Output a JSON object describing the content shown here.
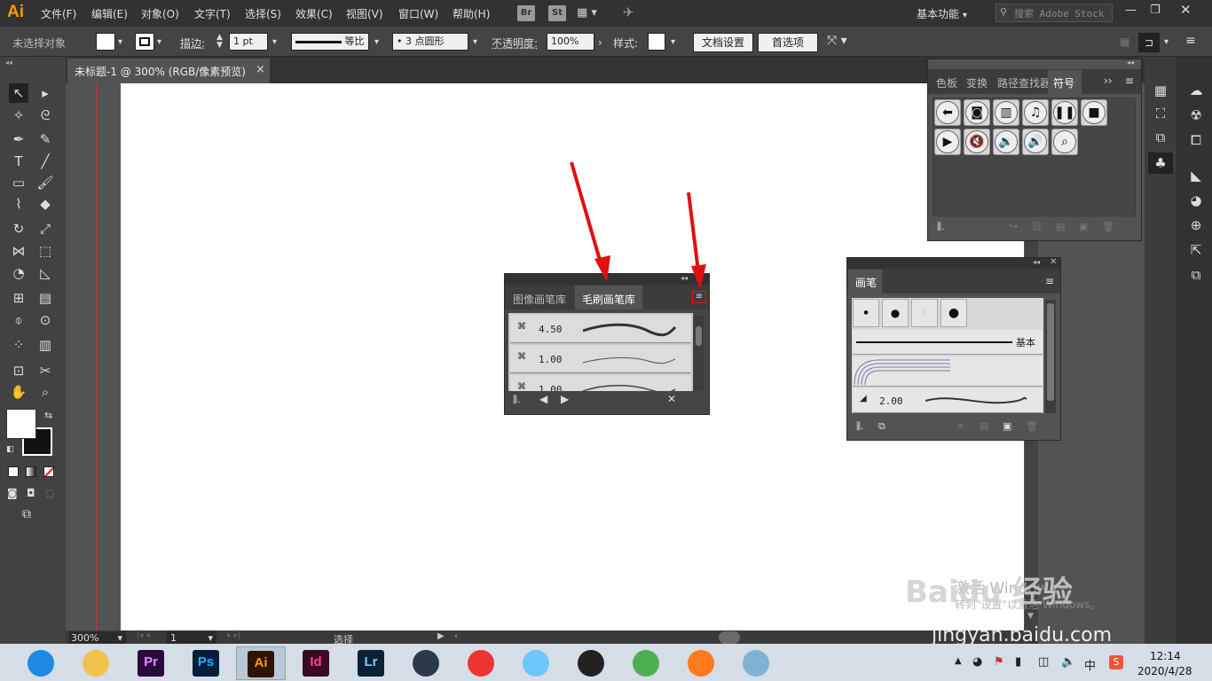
{
  "app": {
    "logo": "Ai"
  },
  "menu": [
    "文件(F)",
    "编辑(E)",
    "对象(O)",
    "文字(T)",
    "选择(S)",
    "效果(C)",
    "视图(V)",
    "窗口(W)",
    "帮助(H)"
  ],
  "appbar": {
    "br": "Br",
    "st": "St",
    "workspace": "基本功能",
    "search_placeholder": "搜索 Adobe Stock"
  },
  "control": {
    "selection": "未选择对象",
    "stroke_label": "描边:",
    "stroke_value": "1 pt",
    "stroke_profile": "等比",
    "brush_def": "3 点圆形",
    "opacity_label": "不透明度:",
    "opacity_value": "100%",
    "style_label": "样式:",
    "doc_setup": "文档设置",
    "preferences": "首选项"
  },
  "document": {
    "tab_title": "未标题-1 @ 300% (RGB/像素预览)",
    "close": "×"
  },
  "status": {
    "zoom": "300%",
    "page": "1",
    "tool": "选择"
  },
  "bristle_panel": {
    "tabs": [
      "图像画笔库",
      "毛刷画笔库"
    ],
    "rows": [
      {
        "label": "4.50"
      },
      {
        "label": "1.00"
      },
      {
        "label": "1.00"
      }
    ]
  },
  "symbols_panel": {
    "tabs": [
      "色板",
      "变换",
      "路径查找器",
      "符号"
    ],
    "icons": [
      "arrow-left-icon",
      "camera-icon",
      "film-icon",
      "music-icon",
      "pause-icon",
      "stop-icon",
      "play-icon",
      "mute-icon",
      "volume-low-icon",
      "volume-high-icon",
      "search-icon"
    ]
  },
  "brushes_panel": {
    "title": "画笔",
    "basic_label": "基本",
    "row_label": "2.00"
  },
  "watermark": {
    "line1": "激活 Windows",
    "line2": "转到\"设置\"以激活 Windows。",
    "brand": "Baidu 经验",
    "url": "jingyan.baidu.com"
  },
  "taskbar": {
    "apps": [
      {
        "name": "browser",
        "label": "",
        "color": "#1e88e5"
      },
      {
        "name": "explorer",
        "label": "",
        "color": "#f2c14e"
      },
      {
        "name": "premiere",
        "label": "Pr",
        "color": "#2a0a3a"
      },
      {
        "name": "photoshop",
        "label": "Ps",
        "color": "#061e3a"
      },
      {
        "name": "illustrator",
        "label": "Ai",
        "color": "#2e1400"
      },
      {
        "name": "indesign",
        "label": "Id",
        "color": "#3a0a20"
      },
      {
        "name": "lightroom",
        "label": "Lr",
        "color": "#0a2233"
      },
      {
        "name": "video",
        "label": "",
        "color": "#2a3a4a"
      },
      {
        "name": "umbrella",
        "label": "",
        "color": "#e33"
      },
      {
        "name": "cat",
        "label": "",
        "color": "#6ec6ff"
      },
      {
        "name": "qq",
        "label": "",
        "color": "#222"
      },
      {
        "name": "chrome",
        "label": "",
        "color": "#4caf50"
      },
      {
        "name": "media",
        "label": "",
        "color": "#ff7a1a"
      },
      {
        "name": "notes",
        "label": "",
        "color": "#7fb3d5"
      }
    ],
    "ime": "中",
    "time": "12:14",
    "date": "2020/4/28"
  }
}
